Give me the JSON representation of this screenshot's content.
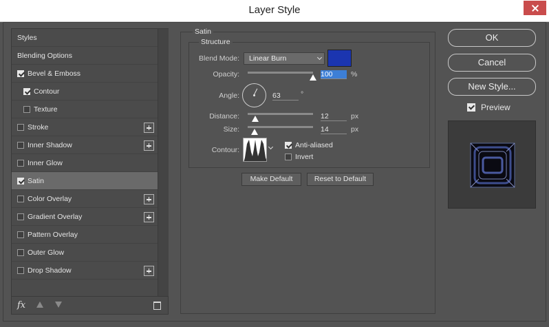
{
  "window": {
    "title": "Layer Style"
  },
  "styles": {
    "items": [
      {
        "label": "Styles",
        "checkbox": false,
        "checked": false,
        "indent": false,
        "plus": false,
        "selected": false
      },
      {
        "label": "Blending Options",
        "checkbox": false,
        "checked": false,
        "indent": false,
        "plus": false,
        "selected": false
      },
      {
        "label": "Bevel & Emboss",
        "checkbox": true,
        "checked": true,
        "indent": false,
        "plus": false,
        "selected": false
      },
      {
        "label": "Contour",
        "checkbox": true,
        "checked": true,
        "indent": true,
        "plus": false,
        "selected": false
      },
      {
        "label": "Texture",
        "checkbox": true,
        "checked": false,
        "indent": true,
        "plus": false,
        "selected": false
      },
      {
        "label": "Stroke",
        "checkbox": true,
        "checked": false,
        "indent": false,
        "plus": true,
        "selected": false
      },
      {
        "label": "Inner Shadow",
        "checkbox": true,
        "checked": false,
        "indent": false,
        "plus": true,
        "selected": false
      },
      {
        "label": "Inner Glow",
        "checkbox": true,
        "checked": false,
        "indent": false,
        "plus": false,
        "selected": false
      },
      {
        "label": "Satin",
        "checkbox": true,
        "checked": true,
        "indent": false,
        "plus": false,
        "selected": true
      },
      {
        "label": "Color Overlay",
        "checkbox": true,
        "checked": false,
        "indent": false,
        "plus": true,
        "selected": false
      },
      {
        "label": "Gradient Overlay",
        "checkbox": true,
        "checked": false,
        "indent": false,
        "plus": true,
        "selected": false
      },
      {
        "label": "Pattern Overlay",
        "checkbox": true,
        "checked": false,
        "indent": false,
        "plus": false,
        "selected": false
      },
      {
        "label": "Outer Glow",
        "checkbox": true,
        "checked": false,
        "indent": false,
        "plus": false,
        "selected": false
      },
      {
        "label": "Drop Shadow",
        "checkbox": true,
        "checked": false,
        "indent": false,
        "plus": true,
        "selected": false
      }
    ],
    "fx_label": "fx"
  },
  "satin": {
    "group_title": "Satin",
    "structure_title": "Structure",
    "blend_mode_label": "Blend Mode:",
    "blend_mode_value": "Linear Burn",
    "color": "#1b35b0",
    "opacity_label": "Opacity:",
    "opacity_value": "100",
    "opacity_unit": "%",
    "opacity_level": 1.0,
    "angle_label": "Angle:",
    "angle_value": "63",
    "angle_unit": "°",
    "distance_label": "Distance:",
    "distance_value": "12",
    "distance_unit": "px",
    "distance_level": 0.12,
    "size_label": "Size:",
    "size_value": "14",
    "size_unit": "px",
    "size_level": 0.1,
    "contour_label": "Contour:",
    "anti_aliased_label": "Anti-aliased",
    "anti_aliased_checked": true,
    "invert_label": "Invert",
    "invert_checked": false,
    "make_default_label": "Make Default",
    "reset_default_label": "Reset to Default"
  },
  "actions": {
    "ok_label": "OK",
    "cancel_label": "Cancel",
    "new_style_label": "New Style...",
    "preview_label": "Preview",
    "preview_checked": true
  }
}
